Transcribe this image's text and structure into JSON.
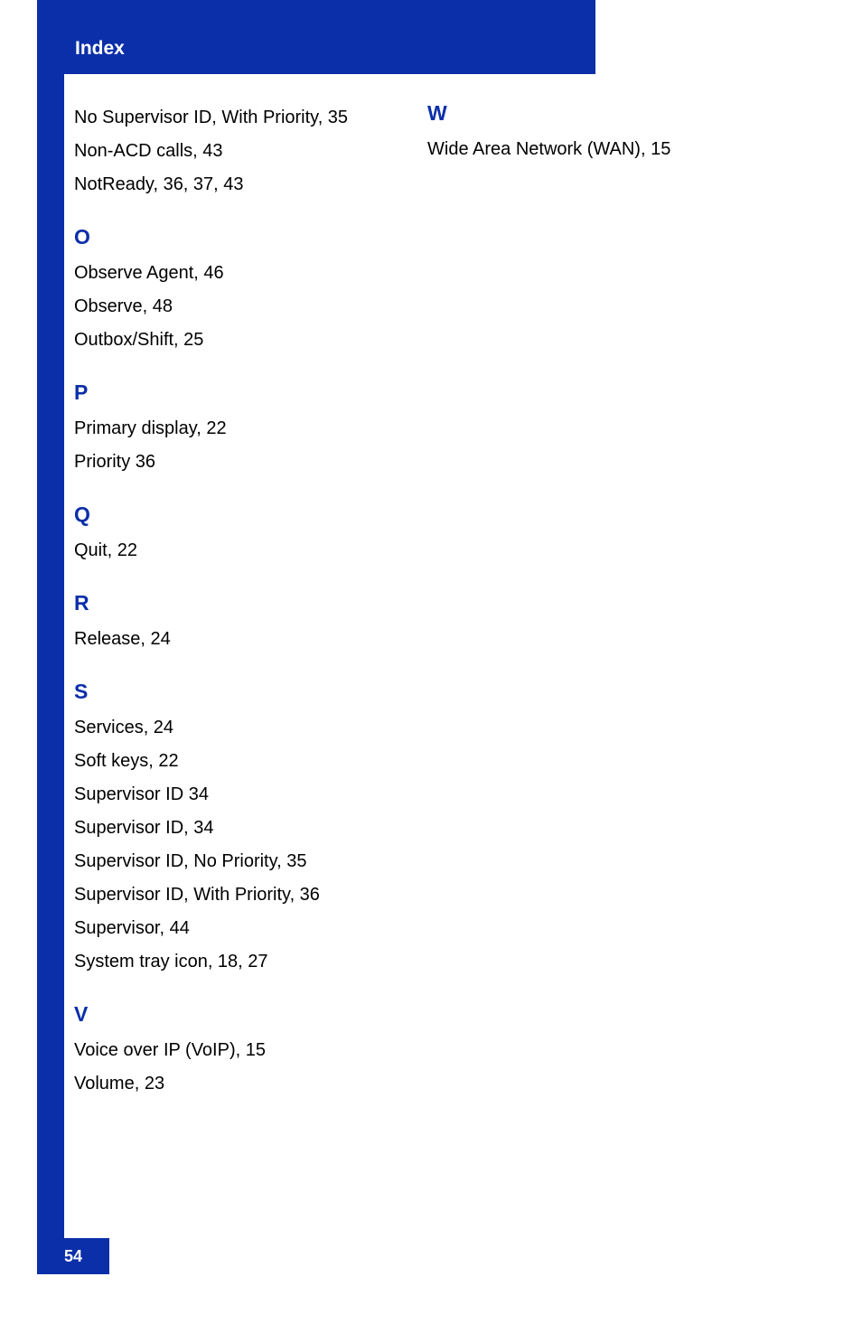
{
  "header": {
    "title": "Index"
  },
  "page_number": "54",
  "left": {
    "continued": [
      "No Supervisor ID, With Priority, 35",
      "Non-ACD calls, 43",
      "NotReady, 36, 37, 43"
    ],
    "sections": [
      {
        "letter": "O",
        "entries": [
          "Observe Agent, 46",
          "Observe, 48",
          "Outbox/Shift, 25"
        ]
      },
      {
        "letter": "P",
        "entries": [
          "Primary display, 22",
          "Priority 36"
        ]
      },
      {
        "letter": "Q",
        "entries": [
          "Quit, 22"
        ]
      },
      {
        "letter": "R",
        "entries": [
          "Release, 24"
        ]
      },
      {
        "letter": "S",
        "entries": [
          "Services, 24",
          "Soft keys, 22",
          "Supervisor ID 34",
          "Supervisor ID, 34",
          "Supervisor ID, No Priority, 35",
          "Supervisor ID, With Priority, 36",
          "Supervisor, 44",
          "System tray icon, 18, 27"
        ]
      },
      {
        "letter": "V",
        "entries": [
          "Voice over IP (VoIP), 15",
          "Volume, 23"
        ]
      }
    ]
  },
  "right": {
    "sections": [
      {
        "letter": "W",
        "entries": [
          "Wide Area Network (WAN), 15"
        ]
      }
    ]
  }
}
